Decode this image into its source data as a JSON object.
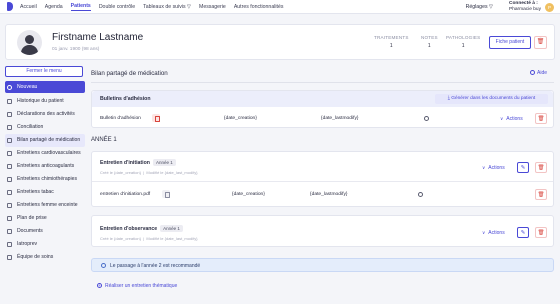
{
  "nav": {
    "items": [
      "Accueil",
      "Agenda",
      "Patients",
      "Double contrôle",
      "Tableaux de suivis",
      "Messagerie",
      "Autres fonctionnalités"
    ],
    "active": "Patients",
    "settings": "Réglages",
    "connected_label": "Connecté à :",
    "pharmacy": "Pharmacie buy",
    "avatar_initial": "P"
  },
  "patient": {
    "name": "Firstname Lastname",
    "dob": "01 janv. 1900 (98 ans)",
    "stats": [
      {
        "label": "TRAITEMENTS",
        "value": "1"
      },
      {
        "label": "NOTES",
        "value": "1"
      },
      {
        "label": "PATHOLOGIES",
        "value": "1"
      }
    ],
    "file_button": "Fiche patient"
  },
  "sidebar": {
    "close_label": "Fermer le menu",
    "items": [
      {
        "label": "Nouveau",
        "icon": "plus-circle-icon"
      },
      {
        "label": "Historique du patient",
        "icon": "history-icon"
      },
      {
        "label": "Déclarations des activités",
        "icon": "clipboard-icon"
      },
      {
        "label": "Conciliation",
        "icon": "document-icon"
      },
      {
        "label": "Bilan partagé de médication",
        "icon": "pill-icon"
      },
      {
        "label": "Entretiens cardiovasculaires",
        "icon": "heart-icon"
      },
      {
        "label": "Entretiens anticoagulants",
        "icon": "drop-icon"
      },
      {
        "label": "Entretiens chimiothérapies",
        "icon": "flask-icon"
      },
      {
        "label": "Entretiens tabac",
        "icon": "cigarette-icon"
      },
      {
        "label": "Entretiens femme enceinte",
        "icon": "pregnant-icon"
      },
      {
        "label": "Plan de prise",
        "icon": "calendar-icon"
      },
      {
        "label": "Documents",
        "icon": "folder-icon"
      },
      {
        "label": "Iatroprev",
        "icon": "shield-icon"
      },
      {
        "label": "Équipe de soins",
        "icon": "team-icon"
      }
    ],
    "selected": "Bilan partagé de médication"
  },
  "main": {
    "title": "Bilan partagé de médication",
    "help": "Aide",
    "adhesion": {
      "title": "Bulletins d'adhésion",
      "generate_button": "Générer dans les documents du patient",
      "row_label": "Bulletin d'adhésion",
      "date_creation": "{date_creation}",
      "date_lastmodify": "{date_lastmodify}",
      "actions": "Actions"
    },
    "year_label": "ANNÉE 1",
    "initiation": {
      "title": "Entretien d'initiation",
      "badge": "Année 1",
      "meta_created": "Créé le {date_creation}",
      "meta_modified": "Modifié le {date_last_modify}",
      "actions": "Actions",
      "file_name": "entretien d'initiation.pdf",
      "date_creation": "{date_creation}",
      "date_lastmodify": "{date_lastmodify}"
    },
    "observance": {
      "title": "Entretien d'observance",
      "badge": "Année 1",
      "meta_created": "Créé le {date_creation}",
      "meta_modified": "Modifié le {date_last_modify}",
      "actions": "Actions"
    },
    "notice": "Le passage à l'année 2 est recommandé",
    "add_link": "Réaliser un entretien thématique"
  },
  "colors": {
    "accent": "#4a49d6",
    "danger": "#d8433b",
    "header_bg": "#eceefb",
    "notice_bg": "#e4edfb"
  }
}
